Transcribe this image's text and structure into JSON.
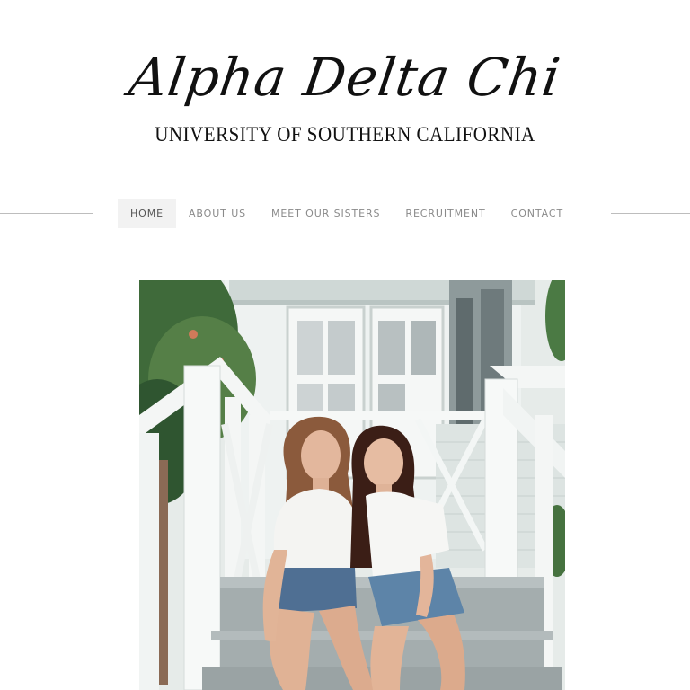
{
  "header": {
    "logo_script": "Alpha Delta Chi",
    "logo_subtitle": "UNIVERSITY OF SOUTHERN CALIFORNIA"
  },
  "nav": {
    "items": [
      {
        "label": "HOME",
        "active": true
      },
      {
        "label": "ABOUT US",
        "active": false
      },
      {
        "label": "MEET OUR SISTERS",
        "active": false
      },
      {
        "label": "RECRUITMENT",
        "active": false
      },
      {
        "label": "CONTACT",
        "active": false
      }
    ]
  },
  "colors": {
    "background": "#ffffff",
    "text": "#111111",
    "nav_text": "#8a8a8a",
    "nav_active_bg": "#f2f2f2",
    "rule": "#bdbdbd"
  }
}
